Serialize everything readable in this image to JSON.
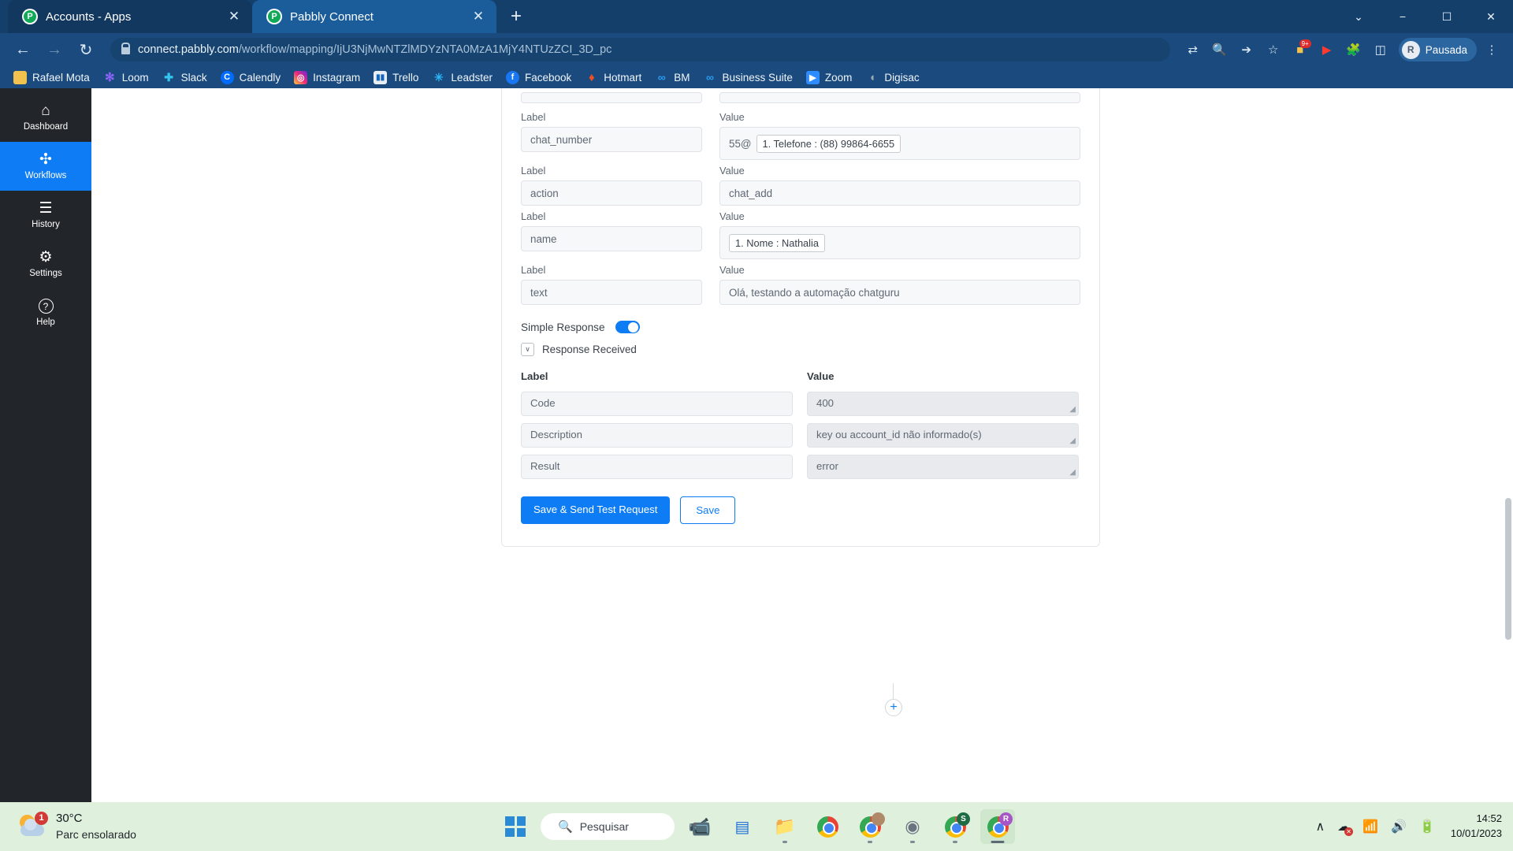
{
  "browser": {
    "tabs": [
      {
        "title": "Accounts - Apps",
        "favicon": "pabbly-icon",
        "active": false
      },
      {
        "title": "Pabbly Connect",
        "favicon": "pabbly-icon",
        "active": true
      }
    ],
    "new_tab_label": "+",
    "window_controls": {
      "minimize": "−",
      "maximize": "☐",
      "close": "✕",
      "chevron": "⌄"
    },
    "nav": {
      "back": "←",
      "forward": "→",
      "reload": "↻"
    },
    "url_host": "connect.pabbly.com",
    "url_path": "/workflow/mapping/IjU3NjMwNTZlMDYzNTA0MzA1MjY4NTUzZCI_3D_pc",
    "toolbar_icons": [
      "translate-icon",
      "search-icon",
      "share-icon",
      "bookmark-star-icon",
      "extension-puzzle-icon",
      "sidepanel-icon"
    ],
    "extension_badge": "9+",
    "profile": {
      "initial": "R",
      "name": "Pausada"
    },
    "bookmarks": [
      {
        "label": "Rafael Mota",
        "icon": "folder-icon",
        "color": "#f2c14e",
        "glyph": ""
      },
      {
        "label": "Loom",
        "icon": "loom-icon",
        "color": "#625df5",
        "glyph": "✻"
      },
      {
        "label": "Slack",
        "icon": "slack-icon",
        "color": "#4a154b",
        "glyph": "#"
      },
      {
        "label": "Calendly",
        "icon": "calendly-icon",
        "color": "#006bff",
        "glyph": "C"
      },
      {
        "label": "Instagram",
        "icon": "instagram-icon",
        "color": "#d62976",
        "glyph": "◎"
      },
      {
        "label": "Trello",
        "icon": "trello-icon",
        "color": "#0079bf",
        "glyph": "▌▐"
      },
      {
        "label": "Leadster",
        "icon": "leadster-icon",
        "color": "#1b4b7e",
        "glyph": "✳"
      },
      {
        "label": "Facebook",
        "icon": "facebook-icon",
        "color": "#1877f2",
        "glyph": "f"
      },
      {
        "label": "Hotmart",
        "icon": "hotmart-icon",
        "color": "#f04e23",
        "glyph": "●"
      },
      {
        "label": "BM",
        "icon": "meta-icon",
        "color": "#1b4b7e",
        "glyph": "∞"
      },
      {
        "label": "Business Suite",
        "icon": "meta-icon",
        "color": "#1b4b7e",
        "glyph": "∞"
      },
      {
        "label": "Zoom",
        "icon": "zoom-icon",
        "color": "#2d8cff",
        "glyph": "▶"
      },
      {
        "label": "Digisac",
        "icon": "digisac-icon",
        "color": "#3a4450",
        "glyph": "◖"
      }
    ]
  },
  "sidebar": {
    "items": [
      {
        "label": "Dashboard",
        "icon": "home-icon",
        "glyph": "⌂",
        "active": false
      },
      {
        "label": "Workflows",
        "icon": "workflows-icon",
        "glyph": "✣",
        "active": true
      },
      {
        "label": "History",
        "icon": "history-list-icon",
        "glyph": "☰",
        "active": false
      },
      {
        "label": "Settings",
        "icon": "gear-icon",
        "glyph": "⚙",
        "active": false
      },
      {
        "label": "Help",
        "icon": "help-circle-icon",
        "glyph": "?",
        "active": false
      }
    ]
  },
  "form": {
    "column_headers": {
      "label": "Label",
      "value": "Value"
    },
    "fields": [
      {
        "label": "chat_number",
        "value_prefix": "55@",
        "value_chip": "1. Telefone : (88) 99864-6655",
        "value": ""
      },
      {
        "label": "action",
        "value_prefix": "",
        "value_chip": "",
        "value": "chat_add"
      },
      {
        "label": "name",
        "value_prefix": "",
        "value_chip": "1. Nome : Nathalia",
        "value": ""
      },
      {
        "label": "text",
        "value_prefix": "",
        "value_chip": "",
        "value": "Olá, testando a automação chatguru"
      }
    ],
    "simple_response": {
      "label": "Simple Response",
      "enabled": true
    },
    "response_received": {
      "label": "Response Received",
      "chevron": "∨"
    },
    "response_table": {
      "headers": {
        "label": "Label",
        "value": "Value"
      },
      "rows": [
        {
          "label": "Code",
          "value": "400"
        },
        {
          "label": "Description",
          "value": "key ou account_id não informado(s)"
        },
        {
          "label": "Result",
          "value": "error"
        }
      ]
    },
    "buttons": {
      "primary": "Save & Send Test Request",
      "secondary": "Save"
    },
    "add_step_label": "+"
  },
  "taskbar": {
    "weather": {
      "temperature": "30°C",
      "description": "Parc ensolarado",
      "badge": "1"
    },
    "search_placeholder": "Pesquisar",
    "start_label": "start-button",
    "apps": [
      {
        "name": "skype-icon",
        "glyph": "■",
        "color": "#8b5cf6",
        "running": false
      },
      {
        "name": "trello-icon",
        "glyph": "▌▐",
        "color": "#1e6fd9",
        "running": false
      },
      {
        "name": "file-explorer-icon",
        "glyph": "🗀",
        "color": "#f5b33c",
        "running": true
      },
      {
        "name": "chrome-icon",
        "glyph": "",
        "color": "#4285f4",
        "running": false
      },
      {
        "name": "chrome-profile-icon",
        "glyph": "",
        "color": "#4285f4",
        "running": true,
        "badge": "",
        "badge_color": "#b08968"
      },
      {
        "name": "ring-device-icon",
        "glyph": "◎",
        "color": "#6b7280",
        "running": true
      },
      {
        "name": "chrome-profile-s-icon",
        "glyph": "",
        "color": "#4285f4",
        "running": true,
        "badge": "S",
        "badge_color": "#1f6b43"
      },
      {
        "name": "chrome-profile-r-icon",
        "glyph": "",
        "color": "#4285f4",
        "running": true,
        "badge": "R",
        "badge_color": "#a855c7"
      }
    ],
    "tray": {
      "chevron": "∧",
      "icons": [
        "onedrive-sync-error-icon",
        "wifi-icon",
        "volume-icon",
        "battery-icon"
      ],
      "time": "14:52",
      "date": "10/01/2023"
    }
  }
}
